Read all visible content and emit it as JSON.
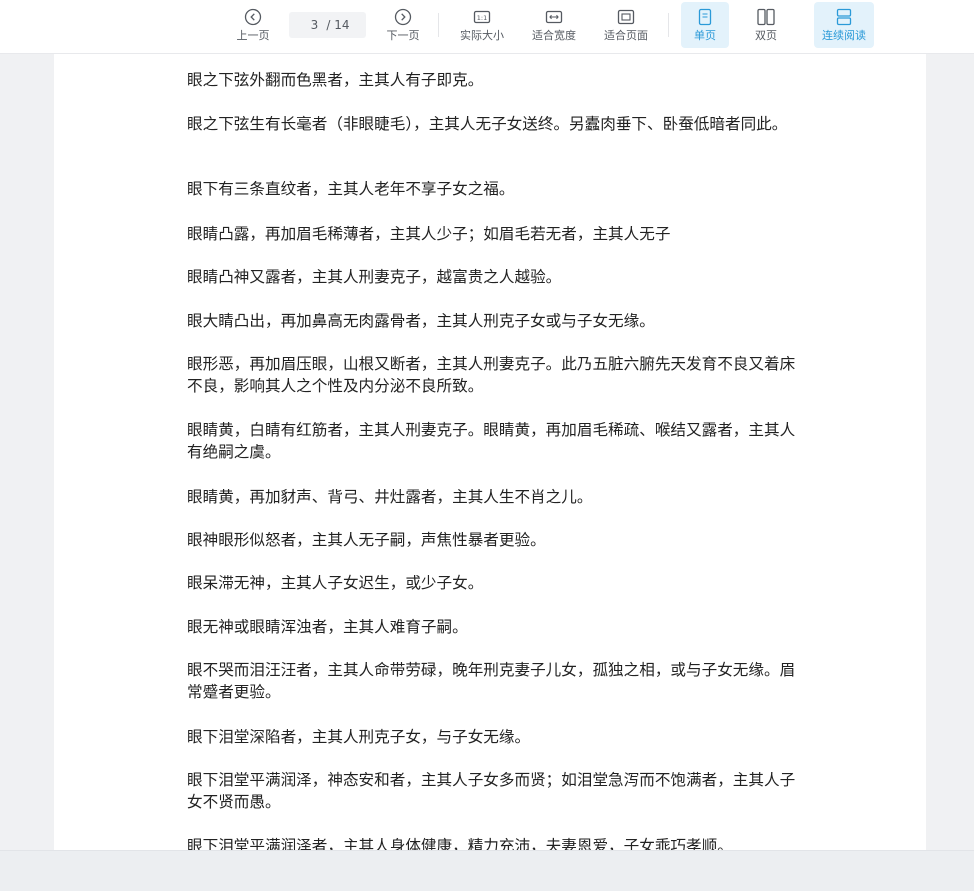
{
  "toolbar": {
    "prev_label": "上一页",
    "page_current": "3",
    "page_total": "/ 14",
    "next_label": "下一页",
    "actual_size_label": "实际大小",
    "fit_width_label": "适合宽度",
    "fit_page_label": "适合页面",
    "single_page_label": "单页",
    "double_page_label": "双页",
    "continuous_label": "连续阅读",
    "active_color": "#2b9ad8"
  },
  "document": {
    "paragraphs": [
      "眼之下弦外翻而色黑者，主其人有子即克。",
      "眼之下弦生有长毫者（非眼睫毛），主其人无子女送终。另蠹肉垂下、卧蚕低暗者同此。",
      "眼下有三条直纹者，主其人老年不享子女之福。",
      "眼睛凸露，再加眉毛稀薄者，主其人少子；如眉毛若无者，主其人无子",
      "眼睛凸神又露者，主其人刑妻克子，越富贵之人越验。",
      "眼大睛凸出，再加鼻高无肉露骨者，主其人刑克子女或与子女无缘。",
      "眼形恶，再加眉压眼，山根又断者，主其人刑妻克子。此乃五脏六腑先天发育不良又着床不良，影响其人之个性及内分泌不良所致。",
      "眼睛黄，白睛有红筋者，主其人刑妻克子。眼睛黄，再加眉毛稀疏、喉结又露者，主其人有绝嗣之虞。",
      "眼睛黄，再加豺声、背弓、井灶露者，主其人生不肖之儿。",
      "眼神眼形似怒者，主其人无子嗣，声焦性暴者更验。",
      "眼呆滞无神，主其人子女迟生，或少子女。",
      "眼无神或眼睛浑浊者，主其人难育子嗣。",
      "眼不哭而泪汪汪者，主其人命带劳碌，晚年刑克妻子儿女，孤独之相，或与子女无缘。眉常蹙者更验。",
      "眼下泪堂深陷者，主其人刑克子女，与子女无缘。",
      "眼下泪堂平满润泽，神态安和者，主其人子女多而贤；如泪堂急泻而不饱满者，主其人子女不贤而愚。",
      "眼下泪堂平满润泽者，主其人身体健康，精力充沛，夫妻恩爱，子女乖巧孝顺。"
    ]
  }
}
